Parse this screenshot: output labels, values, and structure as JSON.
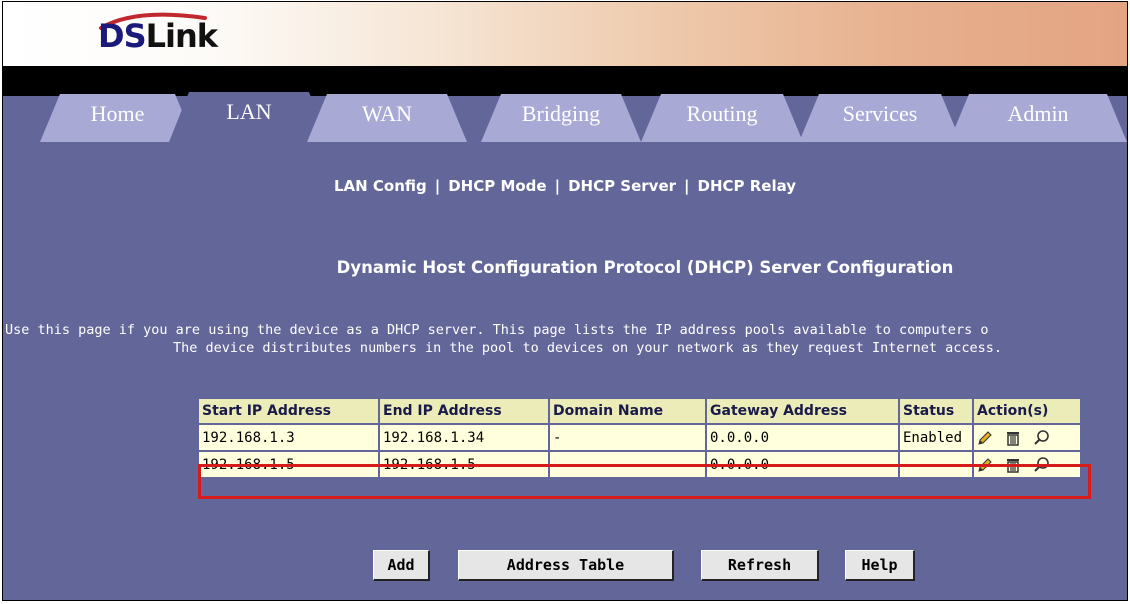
{
  "brand": {
    "logo_ds": "DS",
    "logo_link": "Link"
  },
  "tabs": [
    {
      "label": "Home"
    },
    {
      "label": "LAN"
    },
    {
      "label": "WAN"
    },
    {
      "label": "Bridging"
    },
    {
      "label": "Routing"
    },
    {
      "label": "Services"
    },
    {
      "label": "Admin"
    }
  ],
  "subnav": {
    "items": [
      "LAN Config",
      "DHCP Mode",
      "DHCP Server",
      "DHCP Relay"
    ],
    "separator": "|"
  },
  "page": {
    "title": "Dynamic Host Configuration Protocol (DHCP) Server Configuration",
    "description_line1": "Use this page if you are using the device as a DHCP server. This page lists the IP address pools available to computers o",
    "description_line2": "The device distributes numbers in the pool to devices on your network as they request Internet access."
  },
  "table": {
    "headers": [
      "Start IP Address",
      "End IP Address",
      "Domain Name",
      "Gateway Address",
      "Status",
      "Action(s)"
    ],
    "rows": [
      {
        "start": "192.168.1.3",
        "end": "192.168.1.34",
        "domain": "-",
        "gateway": "0.0.0.0",
        "status": "Enabled"
      },
      {
        "start": "192.168.1.5",
        "end": "192.168.1.5",
        "domain": "-",
        "gateway": "0.0.0.0",
        "status": "-"
      }
    ],
    "highlighted_row_color": "#d61b1b"
  },
  "buttons": {
    "add": "Add",
    "address_table": "Address Table",
    "refresh": "Refresh",
    "help": "Help"
  },
  "colors": {
    "background": "#636699",
    "tab_inactive": "#a9a9d6",
    "header_cell": "#ececb8",
    "data_cell": "#ffffdd"
  }
}
